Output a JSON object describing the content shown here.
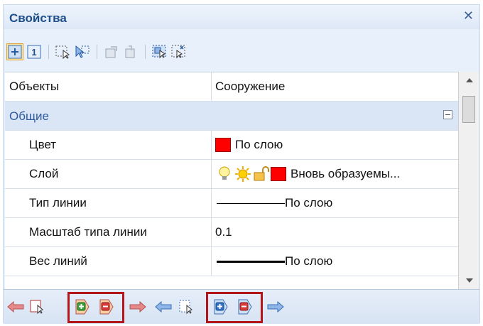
{
  "window": {
    "title": "Свойства",
    "close_glyph": "✕"
  },
  "toolbar": {
    "buttons": [
      {
        "icon": "categorized-icon",
        "active": true
      },
      {
        "icon": "alphabetical-icon",
        "label": "1"
      },
      {
        "icon": "select-objects-icon"
      },
      {
        "icon": "quick-select-icon"
      },
      {
        "icon": "copy-properties-icon"
      },
      {
        "icon": "paste-properties-icon"
      },
      {
        "icon": "select-all-icon"
      },
      {
        "icon": "deselect-icon"
      }
    ]
  },
  "grid": {
    "top_row": {
      "name": "Объекты",
      "value": "Сооружение"
    },
    "group": {
      "name": "Общие",
      "collapsed": false
    },
    "properties": [
      {
        "name": "Цвет",
        "value": "По слою",
        "swatch": "#ff0000"
      },
      {
        "name": "Слой",
        "value": "Вновь образуемы...",
        "swatch": "#ff0000"
      },
      {
        "name": "Тип линии",
        "value": "По слою"
      },
      {
        "name": "Масштаб типа линии",
        "value": "0.1"
      },
      {
        "name": "Вес линий",
        "value": "По слою"
      }
    ]
  },
  "bottom_bar": {
    "items": [
      "back-arrow-icon",
      "filter-icon",
      "add-to-selection-icon",
      "remove-from-selection-icon",
      "forward-arrow-icon",
      "back-arrow-icon",
      "filter-icon",
      "add-to-set-icon",
      "remove-from-set-icon",
      "forward-arrow-icon"
    ],
    "highlight_color": "#b2161b"
  },
  "colors": {
    "accent": "#1f4e8c",
    "group_background": "#dae5f5",
    "swatch_red": "#ff0000"
  }
}
